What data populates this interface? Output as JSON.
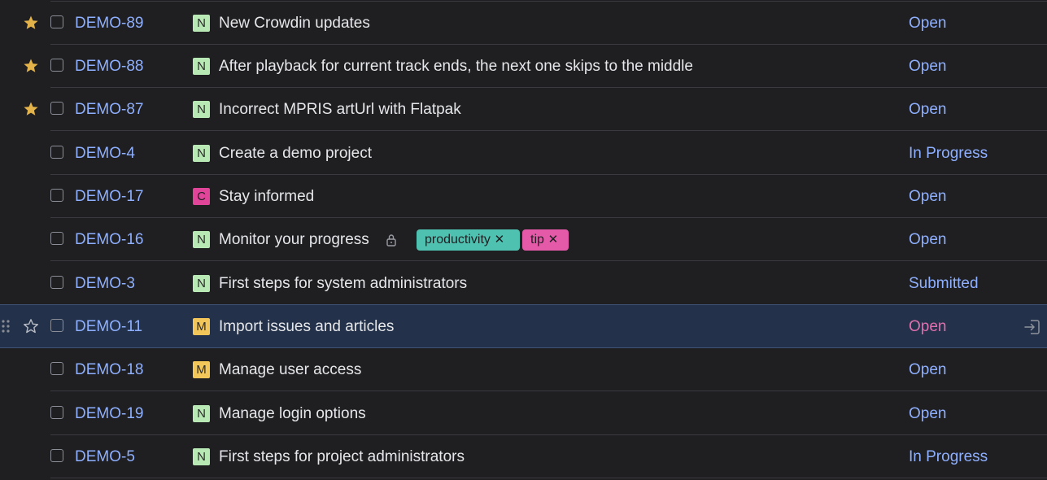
{
  "colors": {
    "background": "#1f1f22",
    "selected_row": "#23324a",
    "link_blue": "#8fb0ff",
    "state_highlight": "#e06fae",
    "star_gold": "#e3b34a",
    "badge_n": "#b8e8b4",
    "badge_c": "#e0459a",
    "badge_m": "#f3c65a",
    "tag_productivity": "#4fc1b0",
    "tag_tip": "#e45aa8"
  },
  "issues": [
    {
      "id": "DEMO-89",
      "type": "N",
      "summary": "New Crowdin updates",
      "state": "Open",
      "starred": true
    },
    {
      "id": "DEMO-88",
      "type": "N",
      "summary": "After playback for current track ends, the next one skips to the middle",
      "state": "Open",
      "starred": true
    },
    {
      "id": "DEMO-87",
      "type": "N",
      "summary": "Incorrect MPRIS artUrl with Flatpak",
      "state": "Open",
      "starred": true
    },
    {
      "id": "DEMO-4",
      "type": "N",
      "summary": "Create a demo project",
      "state": "In Progress",
      "starred": false
    },
    {
      "id": "DEMO-17",
      "type": "C",
      "summary": "Stay informed",
      "state": "Open",
      "starred": false
    },
    {
      "id": "DEMO-16",
      "type": "N",
      "summary": "Monitor your progress",
      "state": "Open",
      "starred": false,
      "locked": true,
      "tags": [
        {
          "label": "productivity",
          "remove_icon": "close-icon"
        },
        {
          "label": "tip",
          "remove_icon": "close-icon"
        }
      ]
    },
    {
      "id": "DEMO-3",
      "type": "N",
      "summary": "First steps for system administrators",
      "state": "Submitted",
      "starred": false
    },
    {
      "id": "DEMO-11",
      "type": "M",
      "summary": "Import issues and articles",
      "state": "Open",
      "starred": false,
      "selected": true
    },
    {
      "id": "DEMO-18",
      "type": "M",
      "summary": "Manage user access",
      "state": "Open",
      "starred": false
    },
    {
      "id": "DEMO-19",
      "type": "N",
      "summary": "Manage login options",
      "state": "Open",
      "starred": false
    },
    {
      "id": "DEMO-5",
      "type": "N",
      "summary": "First steps for project administrators",
      "state": "In Progress",
      "starred": false
    }
  ]
}
